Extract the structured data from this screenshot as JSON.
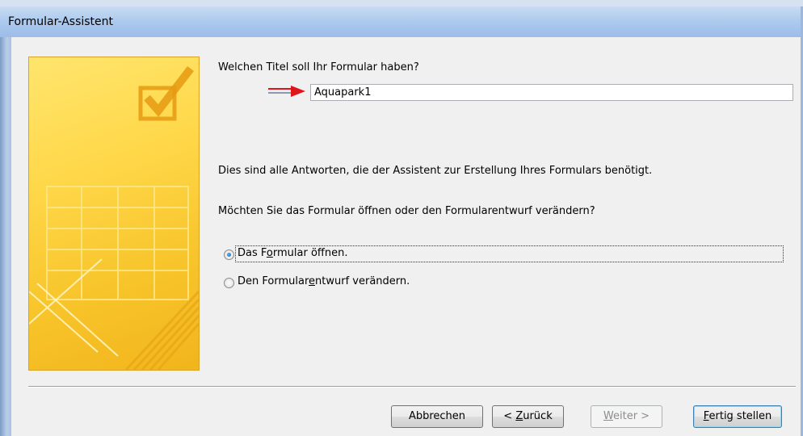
{
  "window": {
    "title": "Formular-Assistent"
  },
  "main": {
    "question_title": "Welchen Titel soll Ihr Formular haben?",
    "title_value": "Aquapark1",
    "info_text": "Dies sind alle Antworten, die der Assistent zur Erstellung Ihres Formulars benötigt.",
    "question_open": "Möchten Sie das Formular öffnen oder den Formularentwurf verändern?",
    "options": [
      {
        "label_pre": "Das F",
        "label_key": "o",
        "label_post": "rmular öffnen.",
        "selected": true
      },
      {
        "label_pre": "Den Formular",
        "label_key": "e",
        "label_post": "ntwurf verändern.",
        "selected": false
      }
    ]
  },
  "buttons": {
    "cancel": "Abbrechen",
    "back_pre": "< ",
    "back_key": "Z",
    "back_post": "urück",
    "next_key": "W",
    "next_post": "eiter >",
    "finish_key": "F",
    "finish_post": "ertig stellen"
  },
  "colors": {
    "banner": "#ffd84a",
    "arrow": "#e0141b",
    "title_bar": "#aecbee"
  }
}
